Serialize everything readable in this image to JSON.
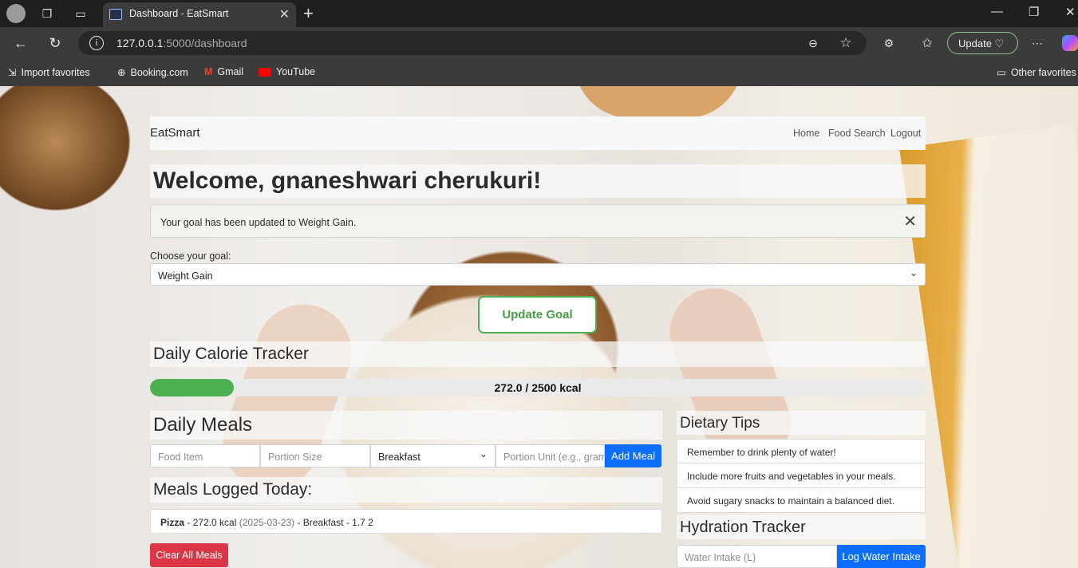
{
  "browser": {
    "tab_title": "Dashboard - EatSmart",
    "url_host": "127.0.0.1",
    "url_path": ":5000/dashboard",
    "update_label": "Update",
    "favorites": [
      "Import favorites",
      "Booking.com",
      "Gmail",
      "YouTube"
    ],
    "other_favorites": "Other favorites"
  },
  "nav": {
    "brand": "EatSmart",
    "links": [
      "Home",
      "Food Search",
      "Logout"
    ]
  },
  "welcome": "Welcome, gnaneshwari cherukuri!",
  "alert": "Your goal has been updated to Weight Gain.",
  "goal": {
    "label": "Choose your goal:",
    "selected": "Weight Gain",
    "button": "Update Goal"
  },
  "calorie_tracker": {
    "title": "Daily Calorie Tracker",
    "consumed": 272.0,
    "target": 2500,
    "progress_fraction": 0.108,
    "label": "272.0 / 2500 kcal"
  },
  "meals": {
    "title": "Daily Meals",
    "food_placeholder": "Food Item",
    "portion_placeholder": "Portion Size",
    "meal_type": "Breakfast",
    "unit_placeholder": "Portion Unit (e.g., gram",
    "add_button": "Add Meal",
    "logged_title": "Meals Logged Today:",
    "logged": [
      {
        "name": "Pizza",
        "kcal": "- 272.0 kcal",
        "date": "(2025-03-23)",
        "rest": "- Breakfast - 1.7 2"
      }
    ],
    "clear_button": "Clear All Meals"
  },
  "tips": {
    "title": "Dietary Tips",
    "items": [
      "Remember to drink plenty of water!",
      "Include more fruits and vegetables in your meals.",
      "Avoid sugary snacks to maintain a balanced diet."
    ]
  },
  "hydration": {
    "title": "Hydration Tracker",
    "placeholder": "Water Intake (L)",
    "button": "Log Water Intake"
  },
  "colors": {
    "accent_green": "#4caf50",
    "primary_blue": "#0d6efd",
    "danger_red": "#dc3545"
  }
}
